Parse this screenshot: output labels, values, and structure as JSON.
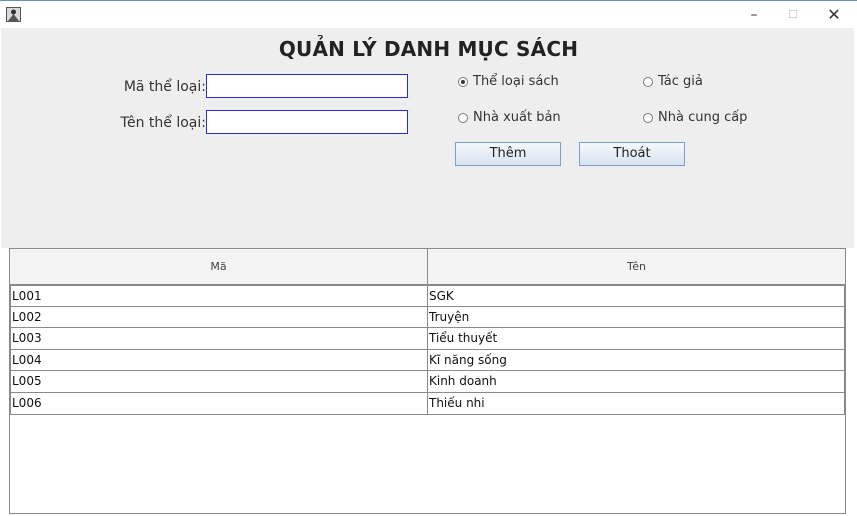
{
  "window": {
    "icon": "java-app-icon",
    "minimize_label": "–",
    "maximize_label": "☐",
    "close_label": "✕"
  },
  "form": {
    "heading": "QUẢN LÝ DANH MỤC SÁCH",
    "code_label": "Mã thể loại:",
    "code_value": "",
    "name_label": "Tên thể loại:",
    "name_value": ""
  },
  "options": [
    {
      "label": "Thể loại sách",
      "selected": true
    },
    {
      "label": "Tác giả",
      "selected": false
    },
    {
      "label": "Nhà xuất bản",
      "selected": false
    },
    {
      "label": "Nhà cung cấp",
      "selected": false
    }
  ],
  "buttons": {
    "add_label": "Thêm",
    "exit_label": "Thoát"
  },
  "table": {
    "columns": [
      "Mã",
      "Tên"
    ],
    "rows": [
      [
        "L001",
        "SGK"
      ],
      [
        "L002",
        "Truyện"
      ],
      [
        "L003",
        "Tiểu thuyết"
      ],
      [
        "L004",
        "Kĩ năng sống"
      ],
      [
        "L005",
        "Kinh doanh"
      ],
      [
        "L006",
        "Thiếu nhi"
      ]
    ]
  }
}
